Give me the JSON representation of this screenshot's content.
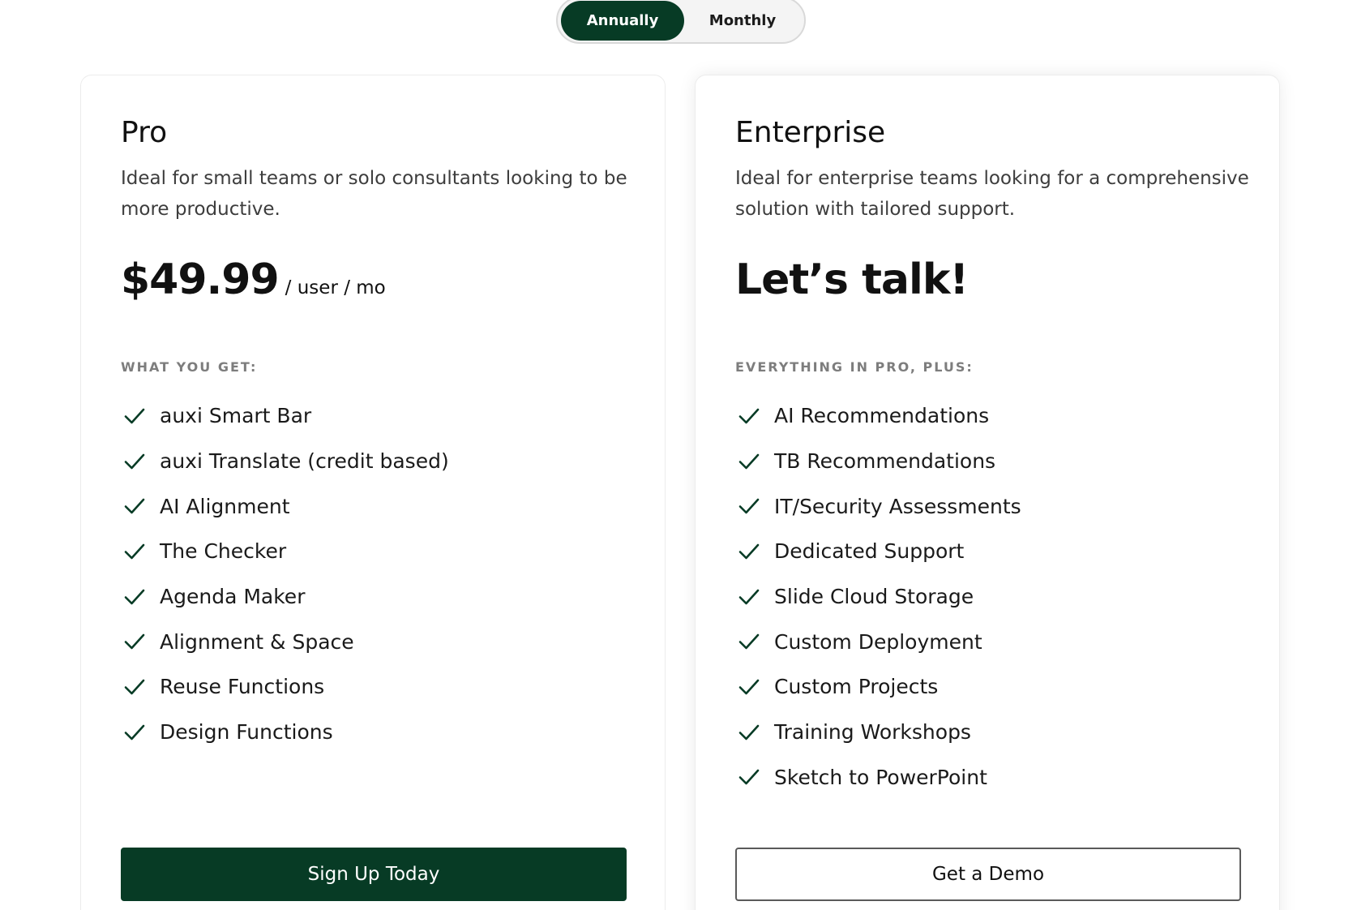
{
  "billing_toggle": {
    "options": [
      "Annually",
      "Monthly"
    ],
    "selected": "Annually"
  },
  "colors": {
    "brand_green": "#073b25",
    "muted_label": "#7d7d7d",
    "check": "#073b25"
  },
  "plans": [
    {
      "name": "Pro",
      "description": "Ideal for small teams or solo consultants looking to be more productive.",
      "price": "$49.99",
      "price_unit": "/ user / mo",
      "features_label": "WHAT YOU GET:",
      "features": [
        "auxi Smart Bar",
        "auxi Translate (credit based)",
        "AI Alignment",
        "The Checker",
        "Agenda Maker",
        "Alignment & Space",
        "Reuse Functions",
        "Design Functions"
      ],
      "cta_label": "Sign Up Today"
    },
    {
      "name": "Enterprise",
      "description": "Ideal for enterprise teams looking for a comprehensive solution with tailored support.",
      "price_text": "Let’s talk!",
      "features_label": "EVERYTHING IN PRO, PLUS:",
      "features": [
        "AI Recommendations",
        "TB Recommendations",
        "IT/Security Assessments",
        "Dedicated Support",
        "Slide Cloud Storage",
        "Custom Deployment",
        "Custom Projects",
        "Training Workshops",
        "Sketch to PowerPoint"
      ],
      "cta_label": "Get a Demo"
    }
  ],
  "icons": {
    "feature_check": "check-icon"
  }
}
